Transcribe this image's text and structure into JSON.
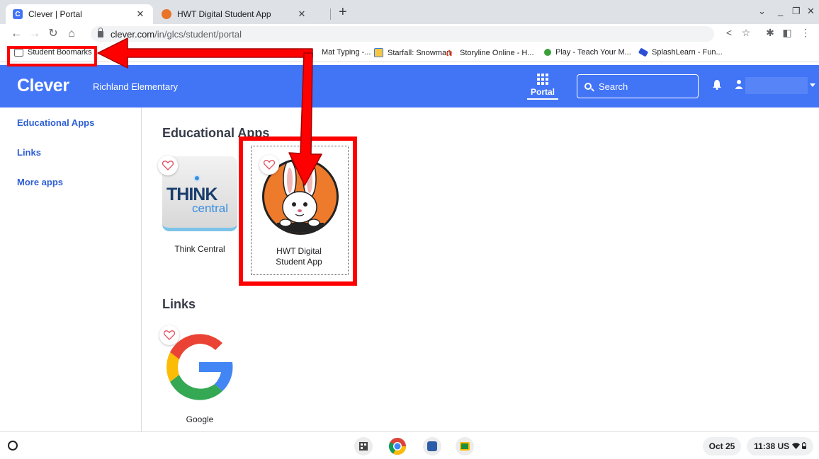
{
  "browser": {
    "tabs": [
      {
        "title": "Clever | Portal",
        "favicon": "C"
      },
      {
        "title": "HWT Digital Student App",
        "favicon": "hwt-bunny-icon"
      }
    ],
    "omnibox": {
      "domain": "clever.com",
      "path": "/in/glcs/student/portal"
    },
    "bookmarks": [
      {
        "label": "Student Boomarks"
      },
      {
        "label": "Mat Typing -..."
      },
      {
        "label": "Starfall: Snowman"
      },
      {
        "label": "Storyline Online - H..."
      },
      {
        "label": "Play - Teach Your M..."
      },
      {
        "label": "SplashLearn - Fun..."
      }
    ]
  },
  "header": {
    "logo": "Clever",
    "school": "Richland Elementary",
    "portal_label": "Portal",
    "search_placeholder": "Search"
  },
  "sidebar": {
    "items": [
      {
        "label": "Educational Apps"
      },
      {
        "label": "Links"
      },
      {
        "label": "More apps"
      }
    ]
  },
  "main": {
    "educational_title": "Educational Apps",
    "apps": [
      {
        "label": "Think Central",
        "logo_text_1": "THINK",
        "logo_text_2": "central"
      },
      {
        "label_1": "HWT Digital",
        "label_2": "Student App"
      }
    ],
    "links_title": "Links",
    "links": [
      {
        "label": "Google"
      }
    ]
  },
  "shelf": {
    "date": "Oct 25",
    "time": "11:38",
    "locale": "US"
  },
  "colors": {
    "clever_blue": "#4274f6",
    "annotation_red": "#ff0000"
  }
}
